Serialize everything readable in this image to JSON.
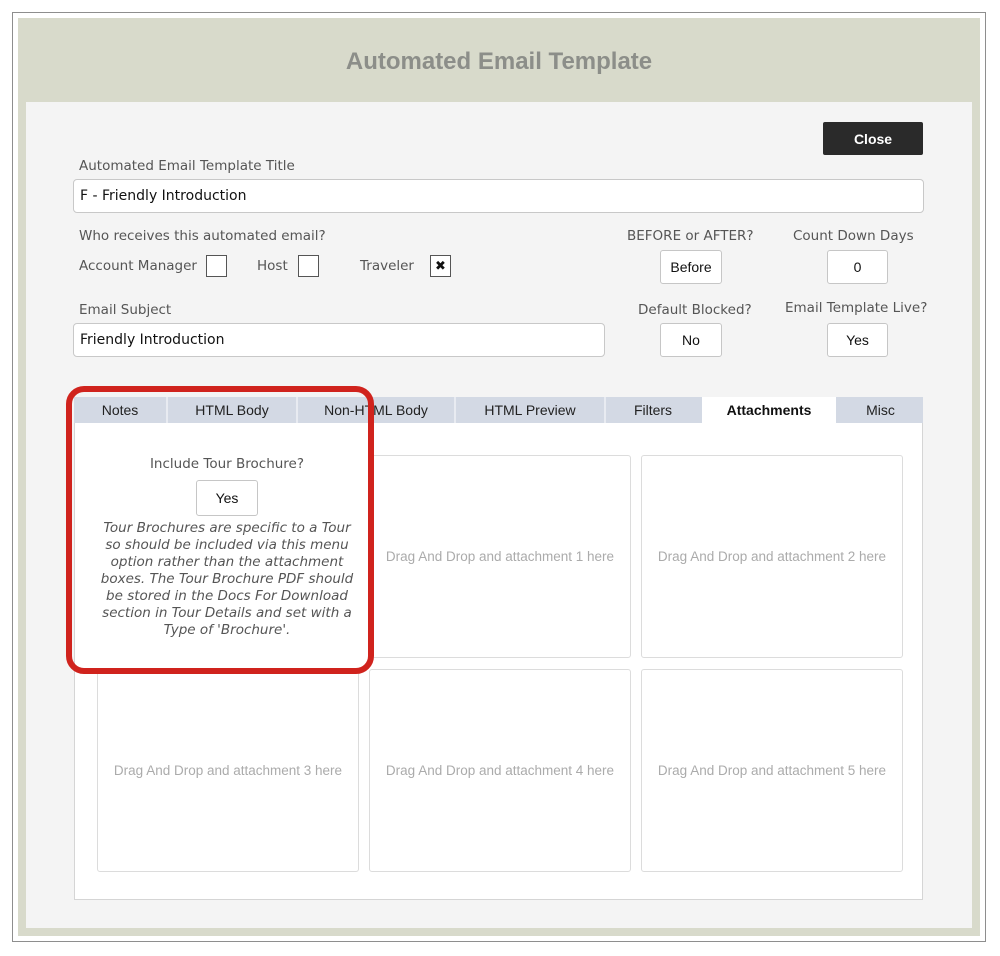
{
  "window": {
    "title": "Automated Email Template"
  },
  "close_label": "Close",
  "template_title": {
    "label": "Automated Email Template Title",
    "value": "F - Friendly Introduction"
  },
  "recipients": {
    "label": "Who receives this automated email?",
    "account_manager": {
      "label": "Account Manager",
      "checked": false
    },
    "host": {
      "label": "Host",
      "checked": false
    },
    "traveler": {
      "label": "Traveler",
      "checked": true,
      "mark": "✖"
    }
  },
  "before_after": {
    "label": "BEFORE or AFTER?",
    "value": "Before"
  },
  "count_down": {
    "label": "Count Down Days",
    "value": "0"
  },
  "email_subject": {
    "label": "Email Subject",
    "value": "Friendly Introduction"
  },
  "default_blocked": {
    "label": "Default Blocked?",
    "value": "No"
  },
  "template_live": {
    "label": "Email Template Live?",
    "value": "Yes"
  },
  "tabs": [
    {
      "label": "Notes",
      "active": false
    },
    {
      "label": "HTML Body",
      "active": false
    },
    {
      "label": "Non-HTML Body",
      "active": false
    },
    {
      "label": "HTML Preview",
      "active": false
    },
    {
      "label": "Filters",
      "active": false
    },
    {
      "label": "Attachments",
      "active": true
    },
    {
      "label": "Misc",
      "active": false
    }
  ],
  "brochure": {
    "question": "Include Tour Brochure?",
    "value": "Yes",
    "note": "Tour Brochures are specific to a Tour so should be included via this menu option rather than the attachment boxes. The Tour Brochure PDF should be stored in the Docs For Download section in Tour Details and set with a Type of 'Brochure'."
  },
  "attachments": [
    "Drag And Drop and attachment 1 here",
    "Drag And Drop and attachment 2 here",
    "Drag And Drop and attachment 3 here",
    "Drag And Drop and attachment 4 here",
    "Drag And Drop and attachment 5 here"
  ],
  "colors": {
    "highlight": "#d0231d",
    "tab_bar": "#d3d9e4",
    "window_bg": "#d8dacb",
    "close_button": "#2a2a2a"
  }
}
